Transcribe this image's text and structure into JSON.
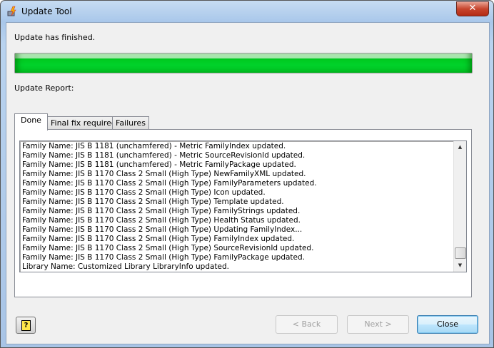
{
  "window": {
    "title": "Update Tool",
    "close_glyph": "✕"
  },
  "status": "Update has finished.",
  "progress": {
    "percent": 100,
    "color": "#00cc22"
  },
  "report_label": "Update Report:",
  "tabs": [
    {
      "label": "Done",
      "active": true
    },
    {
      "label": "Final fix required"
    },
    {
      "label": "Failures"
    }
  ],
  "log": [
    "Family Name: JIS B 1181 (unchamfered) - Metric FamilyIndex updated.",
    "Family Name: JIS B 1181 (unchamfered) - Metric SourceRevisionId updated.",
    "Family Name: JIS B 1181 (unchamfered) - Metric FamilyPackage updated.",
    "Family Name: JIS B 1170 Class 2 Small (High Type) NewFamilyXML updated.",
    "Family Name: JIS B 1170 Class 2 Small (High Type) FamilyParameters updated.",
    "Family Name: JIS B 1170 Class 2 Small (High Type) Icon updated.",
    "Family Name: JIS B 1170 Class 2 Small (High Type) Template updated.",
    "Family Name: JIS B 1170 Class 2 Small (High Type) FamilyStrings updated.",
    "Family Name: JIS B 1170 Class 2 Small (High Type) Health Status updated.",
    "Family Name: JIS B 1170 Class 2 Small (High Type) Updating FamilyIndex...",
    "Family Name: JIS B 1170 Class 2 Small (High Type) FamilyIndex updated.",
    "Family Name: JIS B 1170 Class 2 Small (High Type) SourceRevisionId updated.",
    "Family Name: JIS B 1170 Class 2 Small (High Type) FamilyPackage updated.",
    "Library Name: Customized Library LibraryInfo updated."
  ],
  "buttons": {
    "help": "?",
    "back": "< Back",
    "next": "Next >",
    "close": "Close"
  }
}
